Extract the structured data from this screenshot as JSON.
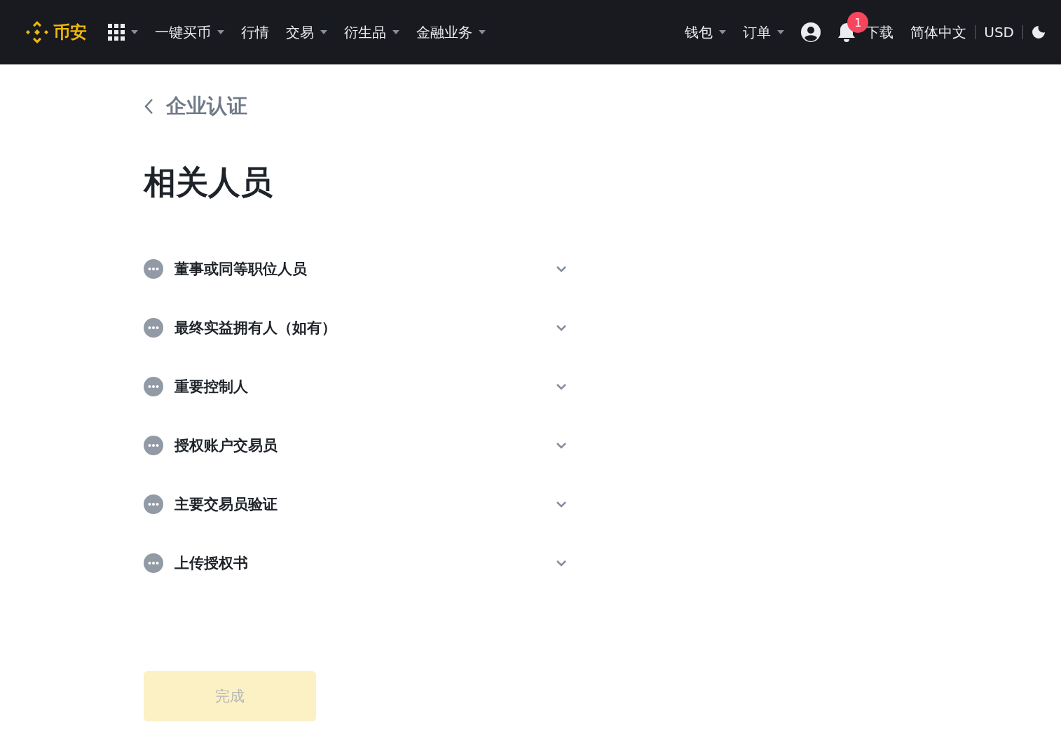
{
  "header": {
    "logo_text": "币安",
    "nav_left": [
      {
        "label": "一键买币",
        "dropdown": true
      },
      {
        "label": "行情",
        "dropdown": false
      },
      {
        "label": "交易",
        "dropdown": true
      },
      {
        "label": "衍生品",
        "dropdown": true
      },
      {
        "label": "金融业务",
        "dropdown": true
      }
    ],
    "nav_right": [
      {
        "label": "钱包",
        "dropdown": true
      },
      {
        "label": "订单",
        "dropdown": true
      }
    ],
    "notification_count": "1",
    "download": "下载",
    "language": "简体中文",
    "currency": "USD"
  },
  "back_link": "企业认证",
  "title": "相关人员",
  "sections": [
    {
      "label": "董事或同等职位人员",
      "expanded": false
    },
    {
      "label": "最终实益拥有人（如有）",
      "expanded": false
    },
    {
      "label": "重要控制人",
      "expanded": false
    },
    {
      "label": "授权账户交易员",
      "expanded": false
    },
    {
      "label": "主要交易员验证",
      "expanded": false
    },
    {
      "label": "上传授权书",
      "expanded": false
    }
  ],
  "done_button": {
    "label": "完成",
    "disabled": true
  }
}
